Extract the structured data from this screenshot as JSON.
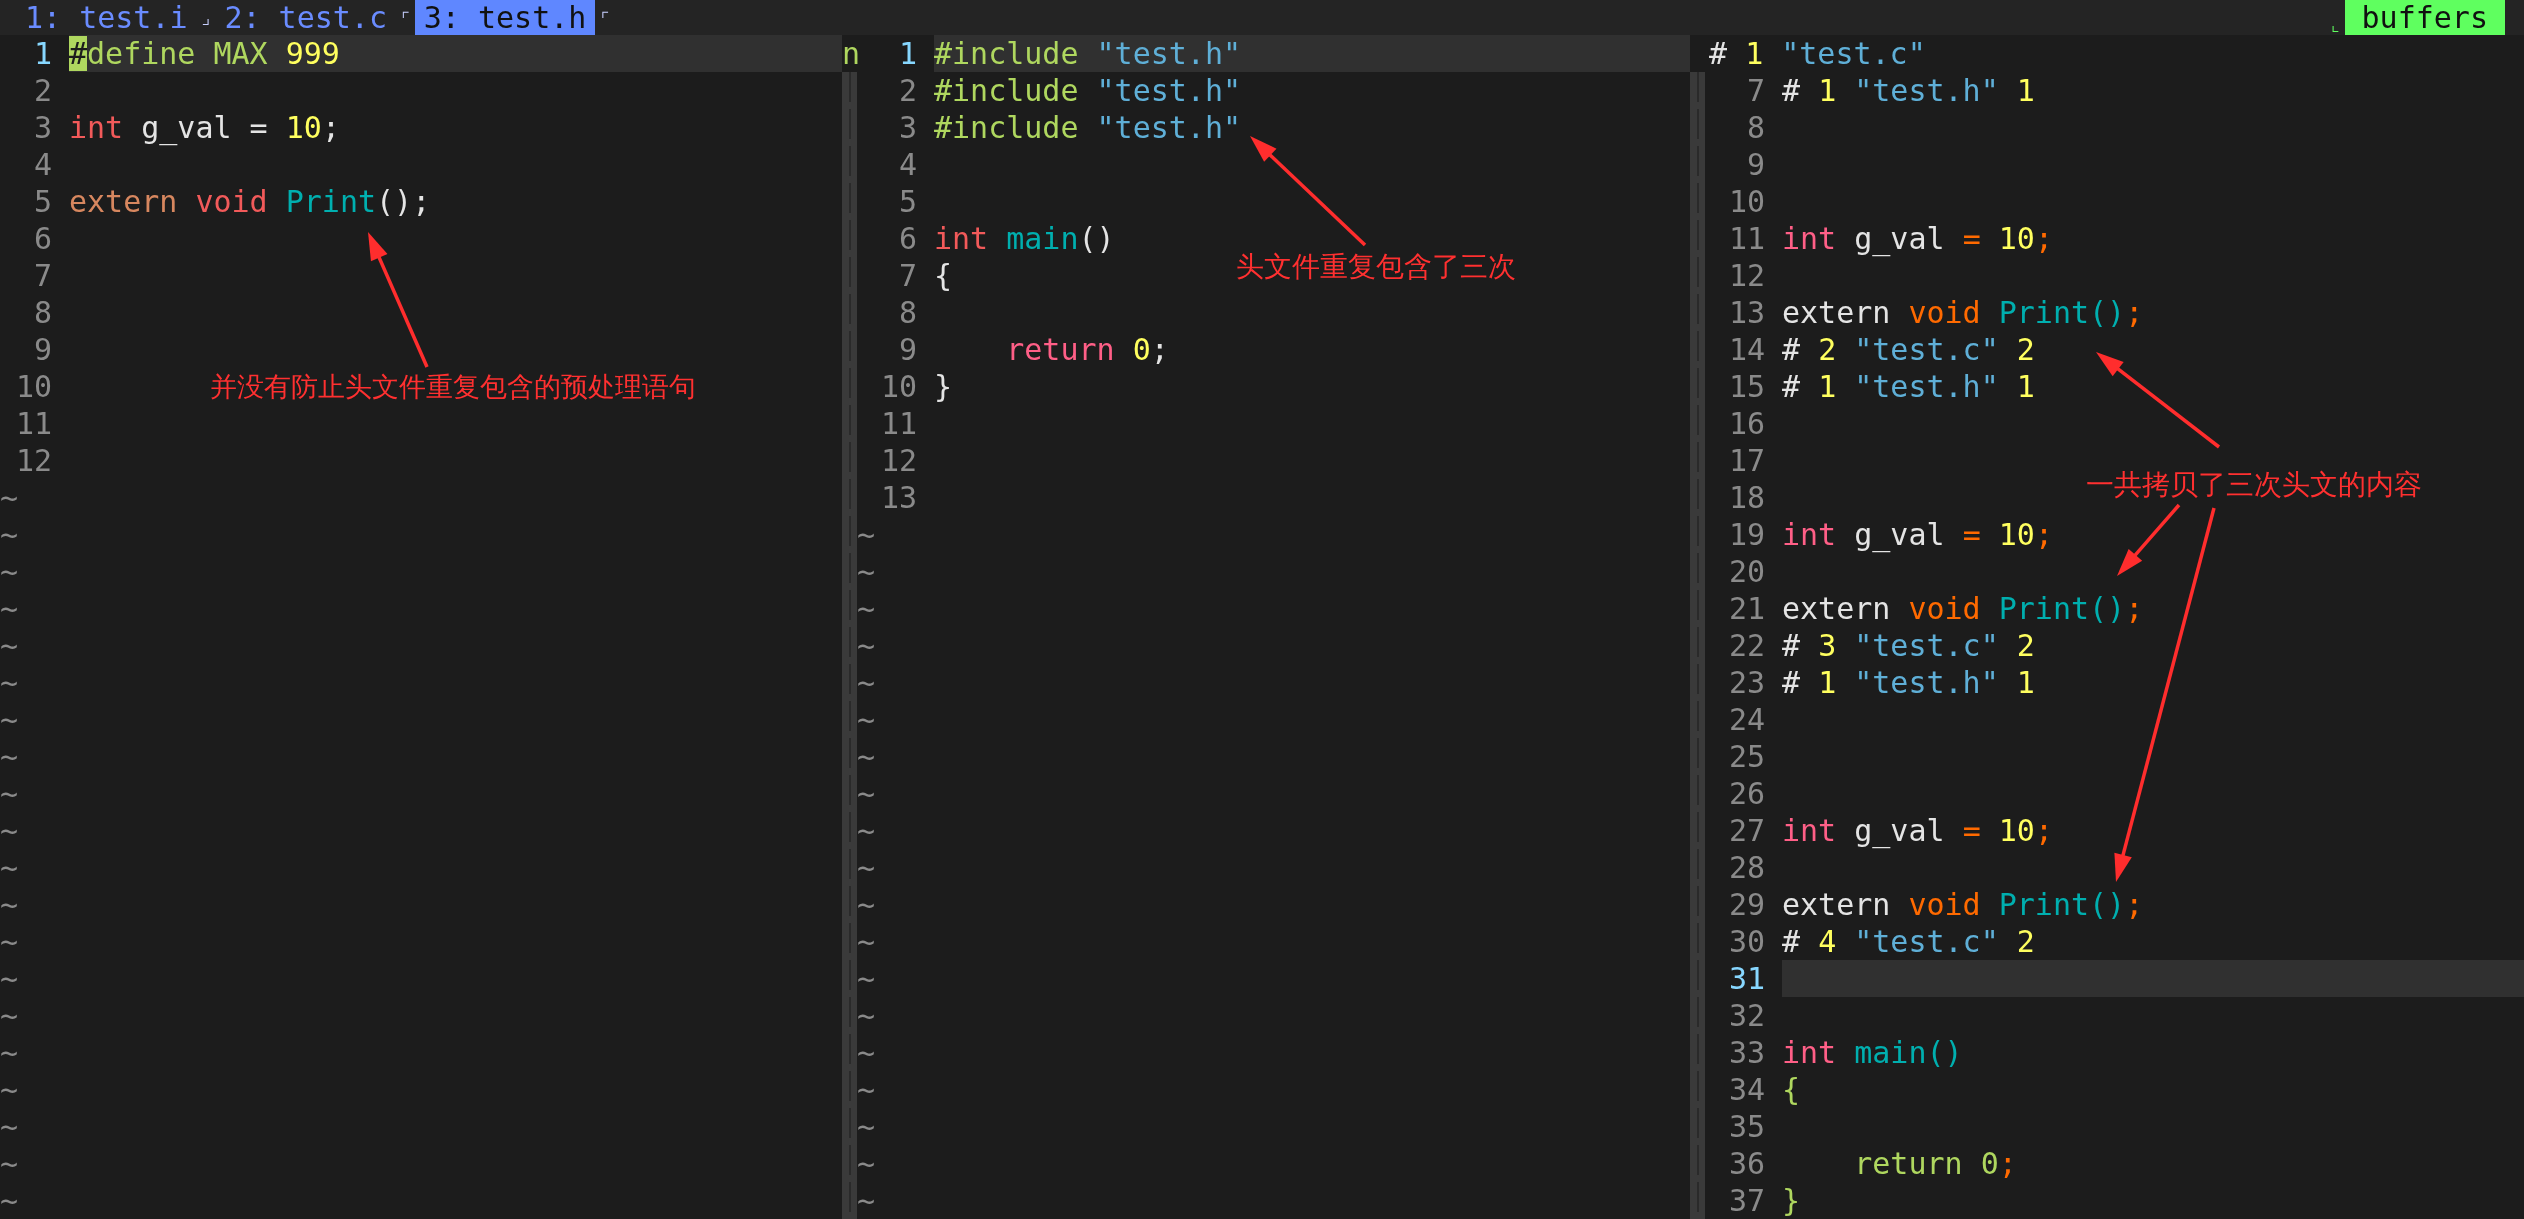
{
  "tabline": {
    "items": [
      {
        "kind": "tab",
        "label": "1: test.i",
        "selected": false
      },
      {
        "kind": "mark",
        "text": "⌟"
      },
      {
        "kind": "tab",
        "label": "2: test.c",
        "selected": false
      },
      {
        "kind": "mark",
        "text": "⌜"
      },
      {
        "kind": "tab",
        "label": "3: test.h",
        "selected": true
      },
      {
        "kind": "mark",
        "text": "⌜"
      }
    ],
    "buffers": {
      "mark": "⌞",
      "label": "buffers"
    }
  },
  "panes": [
    {
      "separator_text": "n",
      "lines": [
        {
          "number": "1",
          "current": true,
          "tokens": [
            {
              "text": "#",
              "kind": "cursor"
            },
            {
              "text": "define MAX ",
              "kind": "preproc"
            },
            {
              "text": "999",
              "kind": "number"
            }
          ]
        },
        {
          "number": "2",
          "current": false
        },
        {
          "number": "3",
          "current": false,
          "tokens": [
            {
              "text": "int",
              "kind": "keyword"
            },
            {
              "text": " g_val = ",
              "kind": "plain"
            },
            {
              "text": "10",
              "kind": "number"
            },
            {
              "text": ";",
              "kind": "plain"
            }
          ]
        },
        {
          "number": "4",
          "current": false
        },
        {
          "number": "5",
          "current": false,
          "tokens": [
            {
              "text": "extern ",
              "kind": "storage"
            },
            {
              "text": "void ",
              "kind": "keyword"
            },
            {
              "text": "Print",
              "kind": "function"
            },
            {
              "text": "();",
              "kind": "plain"
            }
          ]
        },
        {
          "number": "6",
          "current": false
        },
        {
          "number": "7",
          "current": false
        },
        {
          "number": "8",
          "current": false
        },
        {
          "number": "9",
          "current": false
        },
        {
          "number": "10",
          "current": false
        },
        {
          "number": "11",
          "current": false
        },
        {
          "number": "12",
          "current": false
        }
      ],
      "filler_rows": [
        "~",
        "~",
        "~",
        "~",
        "~",
        "~",
        "~",
        "~",
        "~",
        "~",
        "~",
        "~",
        "~",
        "~",
        "~",
        "~",
        "~",
        "~",
        "~",
        "~"
      ]
    },
    {
      "lines": [
        {
          "number": "1",
          "current": true,
          "tokens": [
            {
              "text": "#include ",
              "kind": "preproc"
            },
            {
              "text": "\"test.h\"",
              "kind": "string"
            }
          ]
        },
        {
          "number": "2",
          "current": false,
          "tokens": [
            {
              "text": "#include ",
              "kind": "preproc"
            },
            {
              "text": "\"test.h\"",
              "kind": "string"
            }
          ]
        },
        {
          "number": "3",
          "current": false,
          "tokens": [
            {
              "text": "#include ",
              "kind": "preproc"
            },
            {
              "text": "\"test.h\"",
              "kind": "string"
            }
          ]
        },
        {
          "number": "4",
          "current": false
        },
        {
          "number": "5",
          "current": false
        },
        {
          "number": "6",
          "current": false,
          "tokens": [
            {
              "text": "int ",
              "kind": "keyword"
            },
            {
              "text": "main",
              "kind": "function"
            },
            {
              "text": "()",
              "kind": "plain"
            }
          ]
        },
        {
          "number": "7",
          "current": false,
          "tokens": [
            {
              "text": "{",
              "kind": "plain"
            }
          ]
        },
        {
          "number": "8",
          "current": false
        },
        {
          "number": "9",
          "current": false,
          "tokens": [
            {
              "text": "    return ",
              "kind": "flow"
            },
            {
              "text": "0",
              "kind": "number"
            },
            {
              "text": ";",
              "kind": "plain"
            }
          ]
        },
        {
          "number": "10",
          "current": false,
          "tokens": [
            {
              "text": "}",
              "kind": "plain"
            }
          ]
        },
        {
          "number": "11",
          "current": false
        },
        {
          "number": "12",
          "current": false
        },
        {
          "number": "13",
          "current": false
        }
      ],
      "filler_rows": [
        "~",
        "~",
        "~",
        "~",
        "~",
        "~",
        "~",
        "~",
        "~",
        "~",
        "~",
        "~",
        "~",
        "~",
        "~",
        "~",
        "~",
        "~",
        "~"
      ]
    },
    {
      "lines": [
        {
          "current": false,
          "tokens": [
            {
              "text": "# ",
              "kind": "plain"
            },
            {
              "text": "1 ",
              "kind": "number"
            },
            {
              "text": "\"test.c\"",
              "kind": "string"
            }
          ]
        },
        {
          "number": "7",
          "current": false,
          "tokens": [
            {
              "text": "# ",
              "kind": "plain"
            },
            {
              "text": "1 ",
              "kind": "number"
            },
            {
              "text": "\"test.h\" ",
              "kind": "string"
            },
            {
              "text": "1",
              "kind": "number"
            }
          ]
        },
        {
          "number": "8",
          "current": false
        },
        {
          "number": "9",
          "current": false
        },
        {
          "number": "10",
          "current": false
        },
        {
          "number": "11",
          "current": false,
          "tokens": [
            {
              "text": "int",
              "kind": "type"
            },
            {
              "text": " g_val ",
              "kind": "plain"
            },
            {
              "text": "= ",
              "kind": "accent"
            },
            {
              "text": "10",
              "kind": "number"
            },
            {
              "text": ";",
              "kind": "accent"
            }
          ]
        },
        {
          "number": "12",
          "current": false
        },
        {
          "number": "13",
          "current": false,
          "tokens": [
            {
              "text": "extern ",
              "kind": "plain"
            },
            {
              "text": "void ",
              "kind": "accent"
            },
            {
              "text": "Print()",
              "kind": "function"
            },
            {
              "text": ";",
              "kind": "accent"
            }
          ]
        },
        {
          "number": "14",
          "current": false,
          "tokens": [
            {
              "text": "# ",
              "kind": "plain"
            },
            {
              "text": "2 ",
              "kind": "number"
            },
            {
              "text": "\"test.c\" ",
              "kind": "string"
            },
            {
              "text": "2",
              "kind": "number"
            }
          ]
        },
        {
          "number": "15",
          "current": false,
          "tokens": [
            {
              "text": "# ",
              "kind": "plain"
            },
            {
              "text": "1 ",
              "kind": "number"
            },
            {
              "text": "\"test.h\" ",
              "kind": "string"
            },
            {
              "text": "1",
              "kind": "number"
            }
          ]
        },
        {
          "number": "16",
          "current": false
        },
        {
          "number": "17",
          "current": false
        },
        {
          "number": "18",
          "current": false
        },
        {
          "number": "19",
          "current": false,
          "tokens": [
            {
              "text": "int",
              "kind": "type"
            },
            {
              "text": " g_val ",
              "kind": "plain"
            },
            {
              "text": "= ",
              "kind": "accent"
            },
            {
              "text": "10",
              "kind": "number"
            },
            {
              "text": ";",
              "kind": "accent"
            }
          ]
        },
        {
          "number": "20",
          "current": false
        },
        {
          "number": "21",
          "current": false,
          "tokens": [
            {
              "text": "extern ",
              "kind": "plain"
            },
            {
              "text": "void ",
              "kind": "accent"
            },
            {
              "text": "Print()",
              "kind": "function"
            },
            {
              "text": ";",
              "kind": "accent"
            }
          ]
        },
        {
          "number": "22",
          "current": false,
          "tokens": [
            {
              "text": "# ",
              "kind": "plain"
            },
            {
              "text": "3 ",
              "kind": "number"
            },
            {
              "text": "\"test.c\" ",
              "kind": "string"
            },
            {
              "text": "2",
              "kind": "number"
            }
          ]
        },
        {
          "number": "23",
          "current": false,
          "tokens": [
            {
              "text": "# ",
              "kind": "plain"
            },
            {
              "text": "1 ",
              "kind": "number"
            },
            {
              "text": "\"test.h\" ",
              "kind": "string"
            },
            {
              "text": "1",
              "kind": "number"
            }
          ]
        },
        {
          "number": "24",
          "current": false
        },
        {
          "number": "25",
          "current": false
        },
        {
          "number": "26",
          "current": false
        },
        {
          "number": "27",
          "current": false,
          "tokens": [
            {
              "text": "int",
              "kind": "type"
            },
            {
              "text": " g_val ",
              "kind": "plain"
            },
            {
              "text": "= ",
              "kind": "accent"
            },
            {
              "text": "10",
              "kind": "number"
            },
            {
              "text": ";",
              "kind": "accent"
            }
          ]
        },
        {
          "number": "28",
          "current": false
        },
        {
          "number": "29",
          "current": false,
          "tokens": [
            {
              "text": "extern ",
              "kind": "plain"
            },
            {
              "text": "void ",
              "kind": "accent"
            },
            {
              "text": "Print()",
              "kind": "function"
            },
            {
              "text": ";",
              "kind": "accent"
            }
          ]
        },
        {
          "number": "30",
          "current": false,
          "tokens": [
            {
              "text": "# ",
              "kind": "plain"
            },
            {
              "text": "4 ",
              "kind": "number"
            },
            {
              "text": "\"test.c\" ",
              "kind": "string"
            },
            {
              "text": "2",
              "kind": "number"
            }
          ]
        },
        {
          "number": "31",
          "current": true
        },
        {
          "number": "32",
          "current": false
        },
        {
          "number": "33",
          "current": false,
          "tokens": [
            {
              "text": "int ",
              "kind": "type"
            },
            {
              "text": "main()",
              "kind": "function"
            }
          ]
        },
        {
          "number": "34",
          "current": false,
          "tokens": [
            {
              "text": "{",
              "kind": "statement"
            }
          ]
        },
        {
          "number": "35",
          "current": false
        },
        {
          "number": "36",
          "current": false,
          "tokens": [
            {
              "text": "    return ",
              "kind": "statement"
            },
            {
              "text": "0",
              "kind": "statement"
            },
            {
              "text": ";",
              "kind": "accent"
            }
          ]
        },
        {
          "number": "37",
          "current": false,
          "tokens": [
            {
              "text": "}",
              "kind": "statement"
            }
          ]
        }
      ]
    }
  ],
  "annotations": [
    {
      "text": "并没有防止头文件重复包含的预处理语句"
    },
    {
      "text": "头文件重复包含了三次"
    },
    {
      "text": "一共拷贝了三次头文的内容"
    }
  ]
}
